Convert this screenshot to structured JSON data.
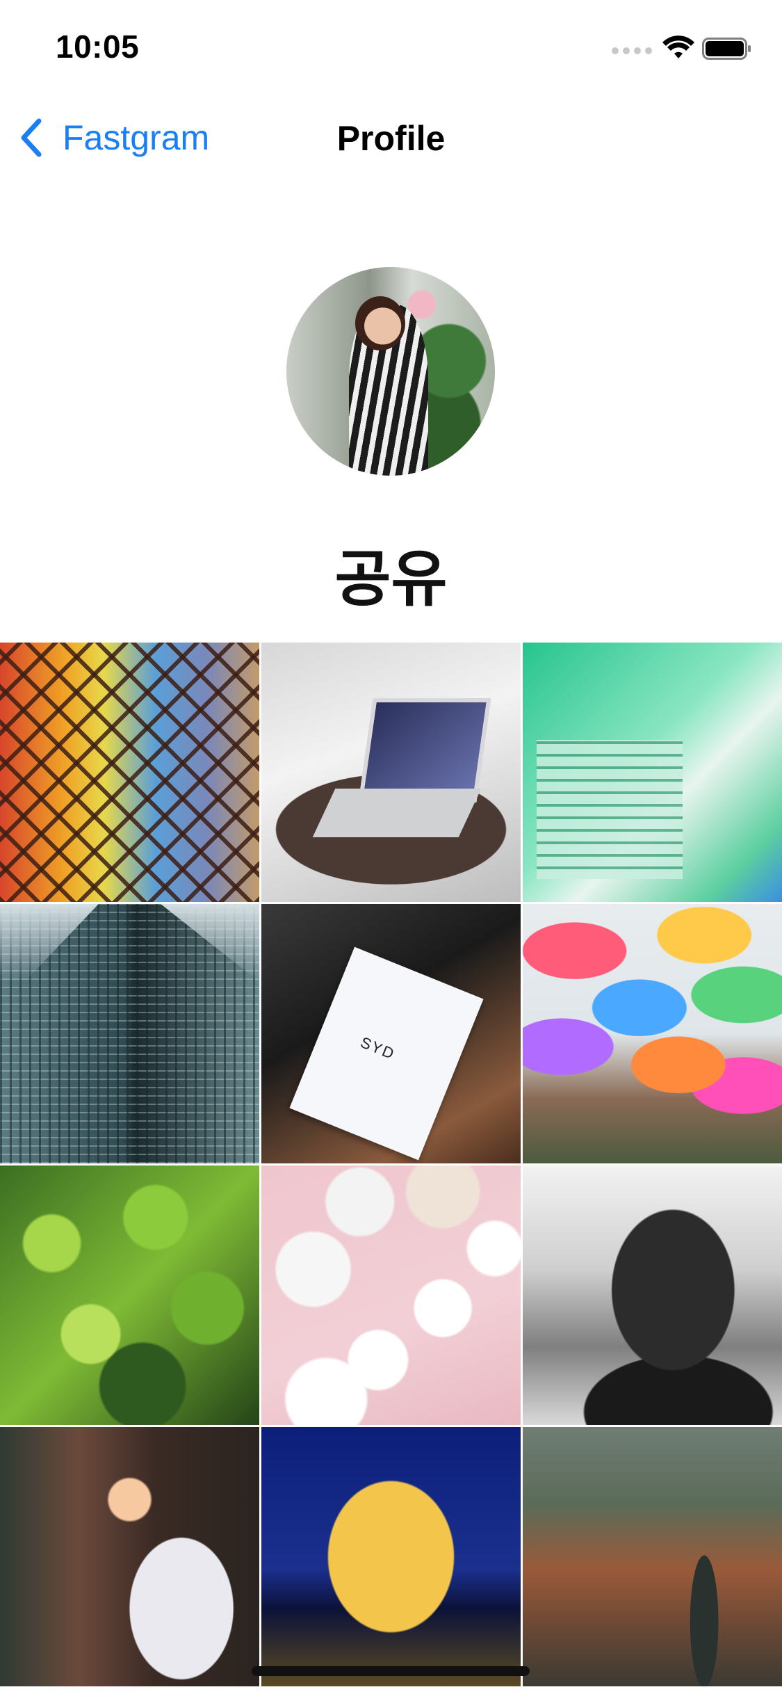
{
  "status_bar": {
    "time": "10:05"
  },
  "nav": {
    "back_label": "Fastgram",
    "title": "Profile"
  },
  "profile": {
    "name": "공유"
  },
  "grid": {
    "photos": [
      {
        "subject": "colorful mosaic tiles"
      },
      {
        "subject": "laptop on round table"
      },
      {
        "subject": "green lab machine"
      },
      {
        "subject": "glass skyscraper"
      },
      {
        "subject": "paper card on table"
      },
      {
        "subject": "hanging umbrellas"
      },
      {
        "subject": "ivy wall"
      },
      {
        "subject": "bowls on pink surface"
      },
      {
        "subject": "black and white portrait"
      },
      {
        "subject": "man working at desk"
      },
      {
        "subject": "illuminated church at night"
      },
      {
        "subject": "statue over old town"
      }
    ],
    "card_text": "SYD"
  },
  "colors": {
    "accent": "#1a7ff5",
    "background": "#ffffff"
  }
}
